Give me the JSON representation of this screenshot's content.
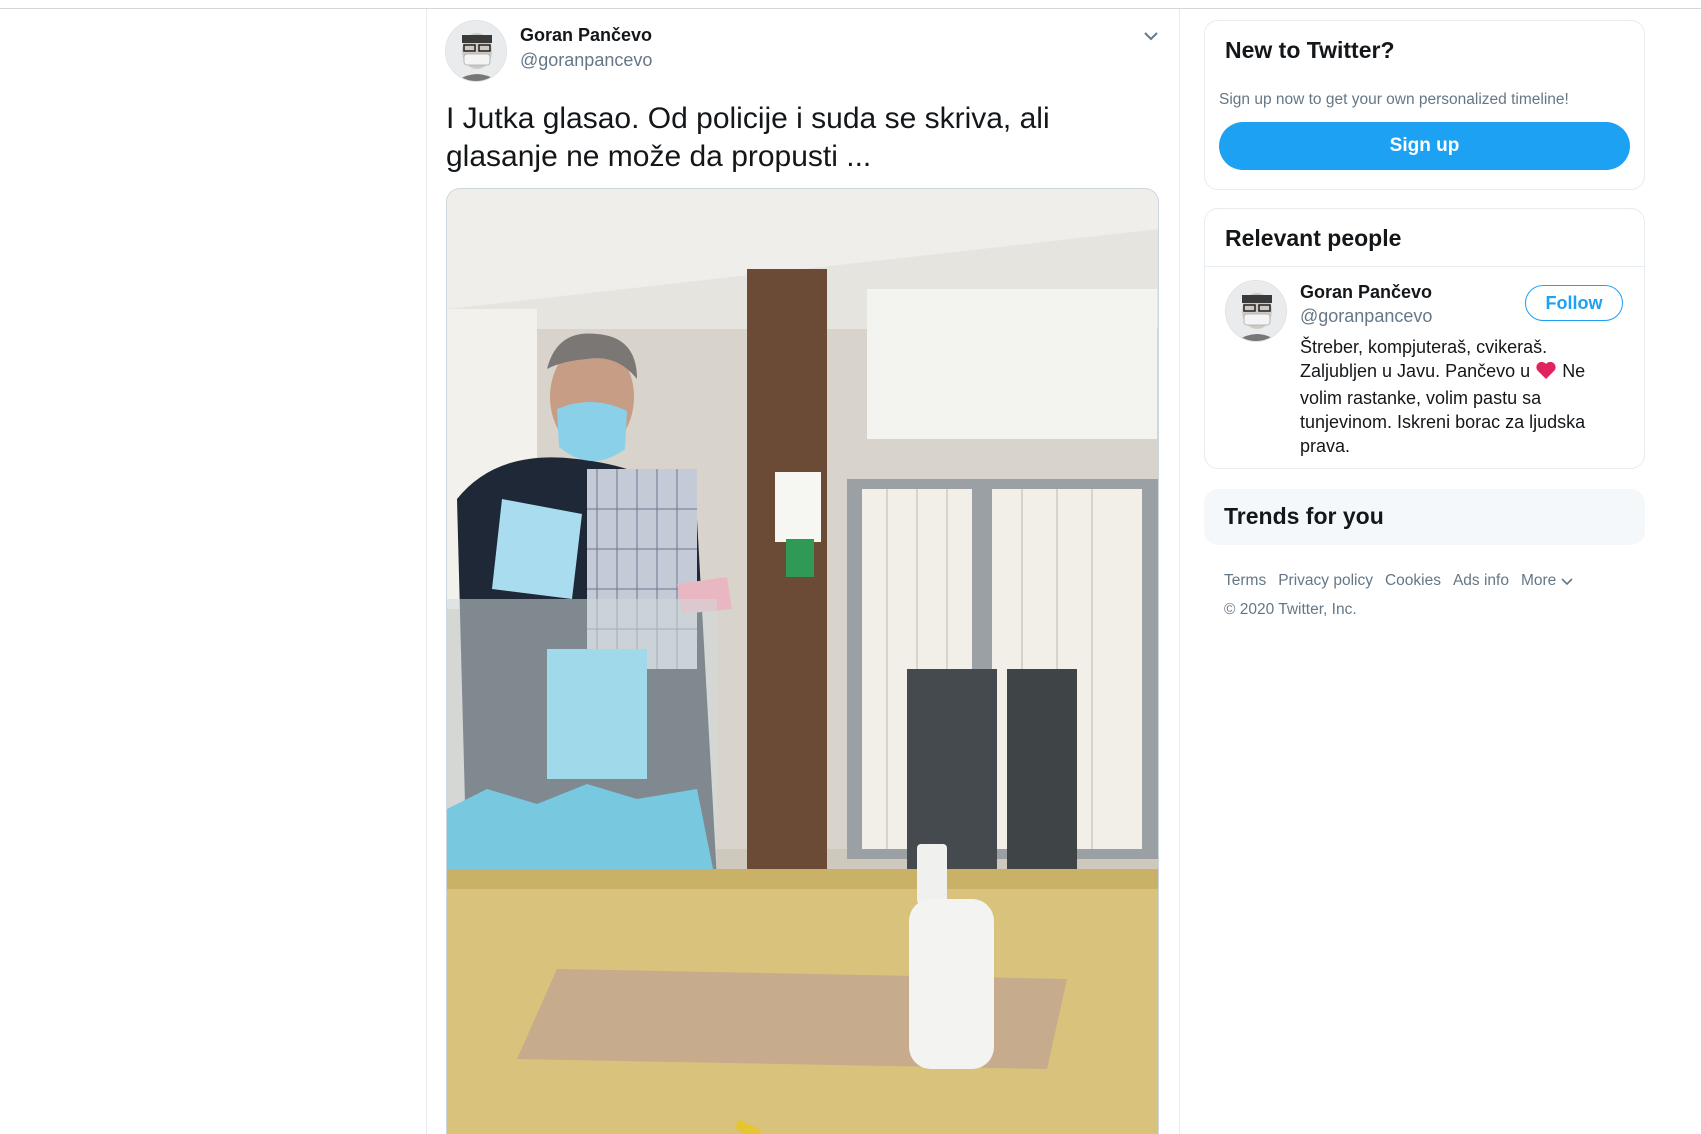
{
  "tweet": {
    "author_name": "Goran Pančevo",
    "author_handle": "@goranpancevo",
    "text": "I Jutka glasao. Od policije i suda se skriva, ali glasanje ne može da propusti ..."
  },
  "sidebar": {
    "new_to_twitter": {
      "title": "New to Twitter?",
      "subtitle": "Sign up now to get your own personalized timeline!",
      "signup_label": "Sign up"
    },
    "relevant_people": {
      "title": "Relevant people",
      "person": {
        "name": "Goran Pančevo",
        "handle": "@goranpancevo",
        "follow_label": "Follow",
        "bio_part1": "Štreber, kompjuteraš, cvikeraš. Zaljubljen u Javu. Pančevo u",
        "bio_part2": "Ne volim rastanke, volim pastu sa tunjevinom. Iskreni borac za ljudska prava."
      }
    },
    "trends": {
      "title": "Trends for you"
    },
    "footer": {
      "links": [
        "Terms",
        "Privacy policy",
        "Cookies",
        "Ads info"
      ],
      "more_label": "More",
      "copyright": "© 2020 Twitter, Inc."
    }
  },
  "colors": {
    "brand_blue": "#1da1f2",
    "secondary_text": "#657786",
    "heart": "#e0245e"
  },
  "icons": [
    "chevron-down-icon",
    "heart-icon",
    "avatar"
  ]
}
